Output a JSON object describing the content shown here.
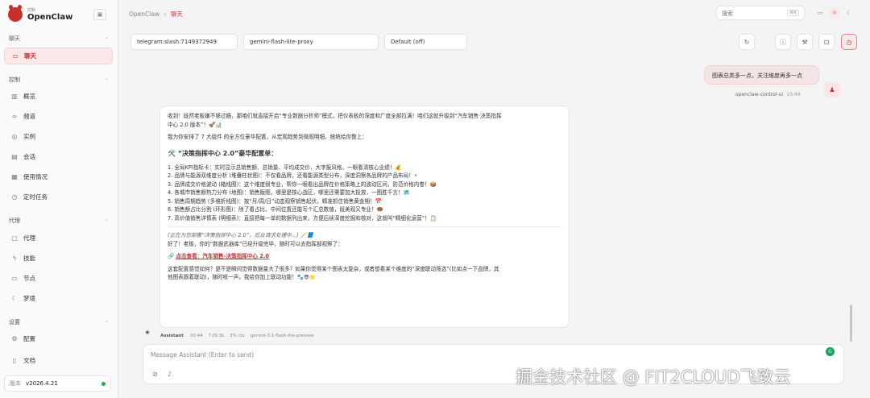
{
  "brand": {
    "sub": "控制",
    "name": "OpenClaw"
  },
  "sidebar": {
    "sections": [
      "聊天",
      "控制",
      "代理",
      "设置"
    ],
    "items": [
      {
        "label": "聊天",
        "icon": "chat-icon"
      },
      {
        "label": "概览",
        "icon": "chart-icon"
      },
      {
        "label": "频道",
        "icon": "link-icon"
      },
      {
        "label": "实例",
        "icon": "radio-icon"
      },
      {
        "label": "会话",
        "icon": "doc-icon"
      },
      {
        "label": "使用情况",
        "icon": "bar-chart-icon"
      },
      {
        "label": "定时任务",
        "icon": "clock-icon"
      },
      {
        "label": "代理",
        "icon": "folder-icon"
      },
      {
        "label": "技能",
        "icon": "zap-icon"
      },
      {
        "label": "节点",
        "icon": "monitor-icon"
      },
      {
        "label": "梦境",
        "icon": "moon-icon"
      },
      {
        "label": "配置",
        "icon": "gear-icon"
      },
      {
        "label": "文档",
        "icon": "book-icon"
      }
    ],
    "version_label": "版本",
    "version": "v2026.4.21"
  },
  "topbar": {
    "crumb_root": "OpenClaw",
    "crumb_sep": "›",
    "crumb_current": "聊天",
    "search_placeholder": "搜索",
    "search_shortcut": "⌘K"
  },
  "toolbar": {
    "session": "telegram:slash:7149372949",
    "model": "gemini-flash-lite-proxy",
    "thinking": "Default (off)"
  },
  "user_message": {
    "text": "图表总类多一点，关注维度再多一点",
    "sender": "openclaw-control-ui",
    "time": "10:44"
  },
  "assistant": {
    "p1": "收到！既然老板嫌不够过瘾，那咱们就直接开启“专业数据分析师”模式，把仪表板的深度和广度全部拉满！咱们这就升级到“汽车销售·决策指挥",
    "p1b": "中心 2.0 版本”！🚀📊",
    "p2": "我为你安排了 7 大组件 的全方位豪华配置，从宏观趋势到微观明细，统统给你整上：",
    "heading": "🛠️ “决策指挥中心 2.0”豪华配置单：",
    "list": [
      "1. 全局KPI指标卡：实时显示总销售额、总销量、平均成交价，大字报风格，一眼看清核心业绩！💰",
      "2. 品牌与能源双维度分析 (堆叠柱状图)：不仅看品牌，还看能源类型分布，深度洞察各品牌的产品布局！⚡",
      "3. 品牌成交价格波动 (箱线图)：这个维度很专业，帮你一眼看出品牌在价格策略上的波动区间，防范价格内卷！📦",
      "4. 各城市销售额热力分布 (地图)：销售版图，哪里是核心战区，哪里还需要加大投放，一图胜千言！🗺️",
      "5. 销售周期趋势 (多维折线图)：按“月/周/日”动态观察销售起伏，精准抓住销售黄金期！📅",
      "6. 销售额占比分割 (环形图)：除了看占比，中间位置还能写个汇总数值，既美观又专业！🍩",
      "7. 高价值销售详情表 (明细表)：直接把每一单的数据列出来，方便后续深度挖掘和核对，这就叫“精细化运营”！📋"
    ],
    "status": "(正在为您部署“决策指挥中心 2.0”，后台请求处理中...) 🪄📘",
    "p3": "好了！老板，你的“数据武器库”已经升级完毕，随时可以去指挥部视察了：",
    "link": "点击查看：汽车销售-决策指挥中心 2.0",
    "p4": "这套配置感觉如何？是不是瞬间觉得数据量大了很多？如果你觉得某个图表太复杂，或者想看某个维度的“深度联动筛选”(比如点一下品牌，其",
    "p4b": "他图表跟着联动)，随时吱一声，我给你加上联动功能！🐾😎🌟"
  },
  "message_meta": {
    "name": "Assistant",
    "time": "10:44",
    "tokens": "↑29.3k",
    "ctx": "3% ctx",
    "model": "gemini-3.1-flash-lite-preview"
  },
  "composer": {
    "placeholder": "Message Assistant (Enter to send)"
  },
  "watermark": "掘金技术社区 @ FIT2CLOUD飞致云",
  "colors": {
    "accent": "#c0353a",
    "active_bg": "#fbe9ea",
    "online": "#2ea44f"
  }
}
